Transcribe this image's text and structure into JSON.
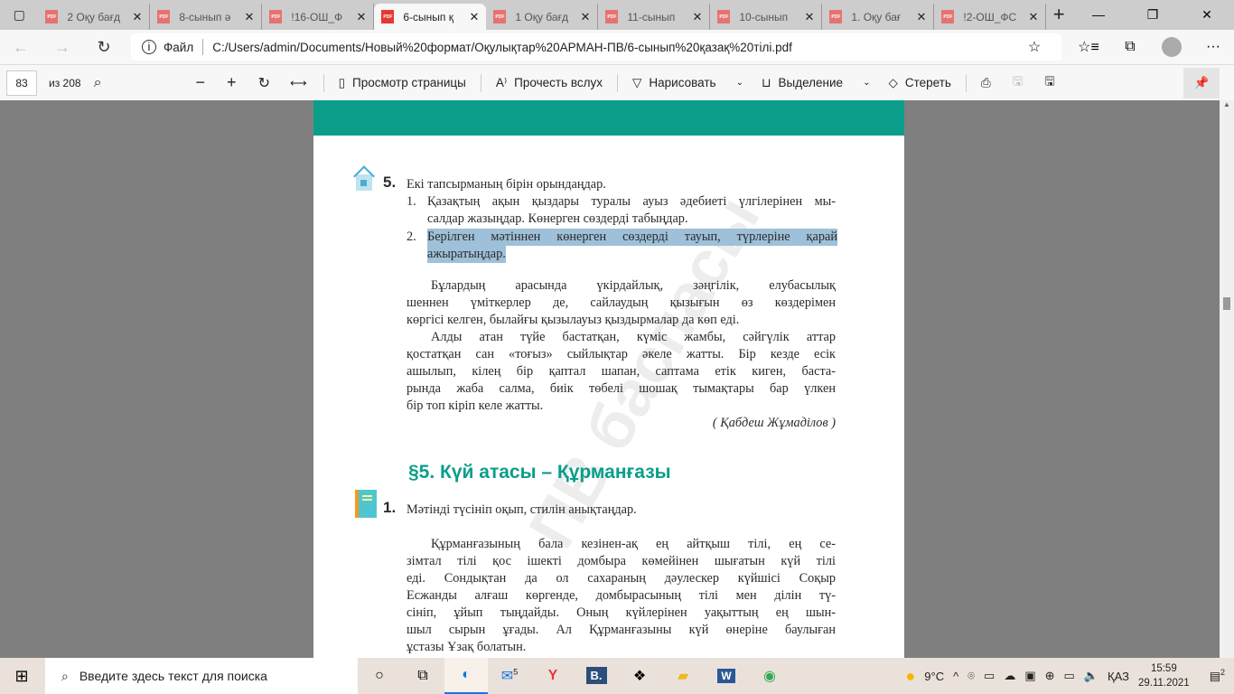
{
  "tabs": [
    {
      "title": "2 Оқу бағд"
    },
    {
      "title": "8-сынып ә"
    },
    {
      "title": "!16-ОШ_Ф"
    },
    {
      "title": "6-сынып қ",
      "active": true
    },
    {
      "title": "1 Оқу бағд"
    },
    {
      "title": "11-сынып"
    },
    {
      "title": "10-сынып"
    },
    {
      "title": "1. Оқу бағ"
    },
    {
      "title": "!2-ОШ_ФС"
    }
  ],
  "address": {
    "scheme_label": "Файл",
    "url": "C:/Users/admin/Documents/Новый%20формат/Оқулықтар%20АРМАН-ПВ/6-сынып%20қазақ%20тілі.pdf"
  },
  "pdf_toolbar": {
    "page": "83",
    "of": "из 208",
    "page_view": "Просмотр страницы",
    "read_aloud": "Прочесть вслух",
    "draw": "Нарисовать",
    "highlight": "Выделение",
    "erase": "Стереть"
  },
  "doc": {
    "task5_num": "5.",
    "task5_title": "Екі тапсырманың бірін орындаңдар.",
    "sub1_num": "1.",
    "sub1_l1": "Қазақтың ақын қыздары туралы ауыз әдебиеті үлгілерінен мы-",
    "sub1_l2": "салдар жазыңдар. Көнерген сөздерді табыңдар.",
    "sub2_num": "2.",
    "sub2_l1": "Берілген мәтіннен көнерген сөздерді тауып, түрлеріне қарай",
    "sub2_l2": "ажыратыңдар.",
    "p1": [
      "Бұлардың арасында үкірдайлық, зәңгілік, елубасылық",
      "шеннен үміткерлер де, сайлаудың қызығын өз көздерімен",
      "көргісі келген, былайғы қызылауыз қыздырмалар да көп еді.",
      "Алды атан түйе бастатқан, күміс жамбы, сәйгүлік аттар",
      "қостатқан сан «тоғыз» сыйлықтар әкеле жатты. Бір кезде есік",
      "ашылып, кілең бір қаптал шапан, саптама етік киген, баста-",
      "рында жаба салма, биік төбелі шошақ тымақтары бар үлкен",
      "бір топ кіріп келе жатты."
    ],
    "author": "( Қабдеш Жұмаділов )",
    "section": "§5. Күй атасы – Құрманғазы",
    "task1_num": "1.",
    "task1_title": "Мәтінді түсініп оқып, стилін анықтаңдар.",
    "p2": [
      "Құрманғазының бала кезінен-ақ ең айтқыш тілі, ең се-",
      "зімтал тілі қос ішекті домбыра көмейінен шығатын күй тілі",
      "еді. Сондықтан да ол сахараның дәулескер күйшісі Соқыр",
      "Есжанды алғаш көргенде, домбырасының тілі мен ділін тү-",
      "сініп, ұйып тыңдайды. Оның күйлерінен уақыттың ең шын-",
      "шыл сырын ұғады. Ал Құрманғазыны күй өнеріне баулыған",
      "ұстазы Ұзақ болатын."
    ],
    "watermark": "ПВ баспасы"
  },
  "taskbar": {
    "search_placeholder": "Введите здесь текст для поиска",
    "mail_badge": "5",
    "weather": "9°C",
    "lang": "ҚАЗ",
    "time": "15:59",
    "date": "29.11.2021",
    "notif_badge": "2"
  },
  "colors": {
    "accent": "#0a9e8a",
    "highlight": "#9ec0d8"
  }
}
